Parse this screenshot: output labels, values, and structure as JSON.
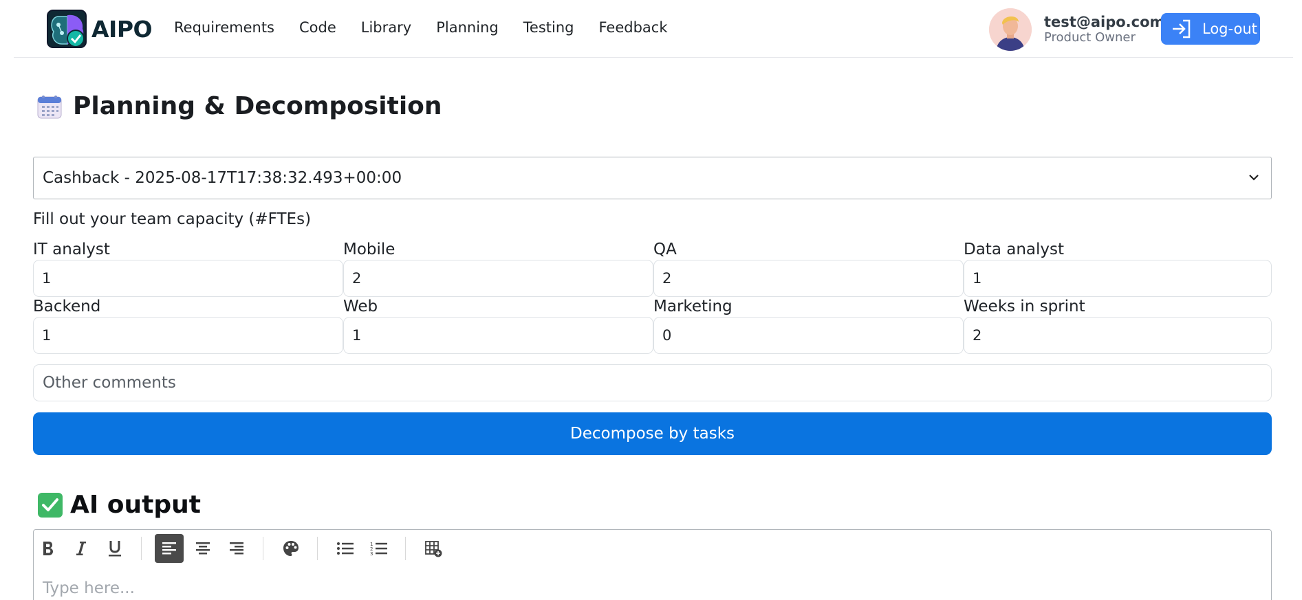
{
  "header": {
    "brand": "AIPO",
    "nav": [
      "Requirements",
      "Code",
      "Library",
      "Planning",
      "Testing",
      "Feedback"
    ],
    "user_email": "test@aipo.com",
    "user_role": "Product Owner",
    "logout_label": "Log-out"
  },
  "page": {
    "title": "Planning & Decomposition",
    "selected_requirement": "Cashback - 2025-08-17T17:38:32.493+00:00",
    "capacity_label": "Fill out your team capacity (#FTEs)",
    "fields": [
      {
        "label": "IT analyst",
        "value": "1"
      },
      {
        "label": "Mobile",
        "value": "2"
      },
      {
        "label": "QA",
        "value": "2"
      },
      {
        "label": "Data analyst",
        "value": "1"
      },
      {
        "label": "Backend",
        "value": "1"
      },
      {
        "label": "Web",
        "value": "1"
      },
      {
        "label": "Marketing",
        "value": "0"
      },
      {
        "label": "Weeks in sprint",
        "value": "2"
      }
    ],
    "comments_placeholder": "Other comments",
    "decompose_label": "Decompose by tasks"
  },
  "output": {
    "title": "AI output",
    "editor_placeholder": "Type here..."
  },
  "colors": {
    "primary": "#0a74e0",
    "logout": "#3b82f6",
    "brand": "#0f2833"
  }
}
